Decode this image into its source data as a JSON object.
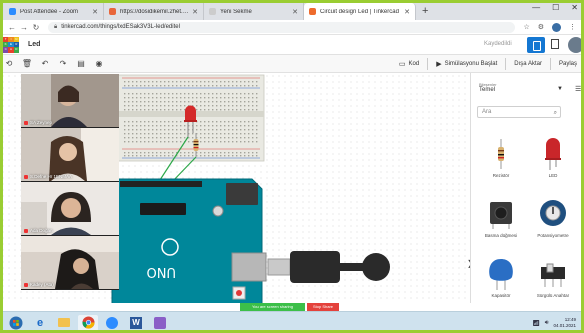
{
  "browser": {
    "tabs": [
      {
        "label": "Post Attendee - Zoom",
        "favicon_color": "#2d8cff",
        "active": false
      },
      {
        "label": "https://dosidikemil.2het.com/??",
        "favicon_color": "#e8663b",
        "active": false
      },
      {
        "label": "Yeni Sekme",
        "favicon_color": "#cccccc",
        "active": false
      },
      {
        "label": "Circuit design Led | Tinkercad",
        "favicon_color": "#ee6b2d",
        "active": true
      }
    ],
    "new_tab": "+",
    "address": "tinkercad.com/things/lxdESak3V3L-led/editel"
  },
  "tinkercad": {
    "project_name": "Led",
    "saved_status": "Kaydedildi",
    "toolbar": {
      "code_label": "Kod",
      "simulate_label": "Simülasyonu Başlat",
      "export_label": "Dışa Aktar",
      "share_label": "Paylaş"
    },
    "panel": {
      "filter_title": "Bileşenler",
      "filter_value": "Temel",
      "search_placeholder": "Ara",
      "components": [
        {
          "label": "Rezistör",
          "icon": "resistor-icon"
        },
        {
          "label": "LED",
          "icon": "led-icon"
        },
        {
          "label": "Basma düğmesi",
          "icon": "pushbutton-icon"
        },
        {
          "label": "Potansiyometre",
          "icon": "potentiometer-icon"
        },
        {
          "label": "Kapasitör",
          "icon": "capacitor-icon"
        },
        {
          "label": "Sürgülü Anahtar",
          "icon": "slide-switch-icon"
        }
      ]
    }
  },
  "video_call": {
    "participants": [
      {
        "name": "SA Zeynep",
        "bg": "#8b7f75"
      },
      {
        "name": "S.Defne Hr 1ENMAA",
        "bg": "#6e5f52"
      },
      {
        "name": "Ada Doğan",
        "bg": "#b9aba0"
      },
      {
        "name": "Kadey (Ata)",
        "bg": "#7a6a60"
      }
    ]
  },
  "screen_share": {
    "status": "You are screen sharing",
    "stop_label": "Stop Share"
  },
  "taskbar": {
    "time": "12:49",
    "date": "04.01.2021"
  },
  "colors": {
    "accent": "#1477d2",
    "arduino": "#00879a",
    "breadboard": "#e9e9e2"
  }
}
